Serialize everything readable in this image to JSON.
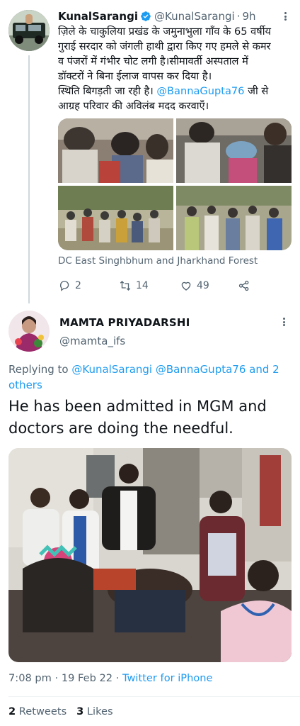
{
  "tweet1": {
    "display_name": "KunalSarangi",
    "handle": "@KunalSarangi",
    "separator": "·",
    "time": "9h",
    "text_lines": [
      "ज़िले के चाकुलिया प्रखंड के जमुनाभुला गाँव के 65 वर्षीय",
      "गुराई सरदार को जंगली हाथी द्वारा किए गए हमले से कमर",
      "व पंजरों में गंभीर चोट लगी है।सीमावर्ती अस्पताल में",
      "डॉक्टरों ने बिना ईलाज वापस कर दिया है।",
      "स्थिति बिगड़ती जा रही है।"
    ],
    "mention": "@BannaGupta76",
    "text_last_line": "जी से",
    "text_final": "आग्रह परिवार की अविलंब मदद करवाएँ।",
    "media_tag": "DC East Singhbhum and Jharkhand Forest",
    "reply_count": "2",
    "retweet_count": "14",
    "like_count": "49"
  },
  "tweet2": {
    "display_name": "MAMTA PRIYADARSHI",
    "handle": "@mamta_ifs",
    "replying_prefix": "Replying to",
    "replying_mention1": "@KunalSarangi",
    "replying_mention2": "@BannaGupta76",
    "replying_and": "and 2",
    "replying_others": "others",
    "text_line1": "He has been admitted in MGM and",
    "text_line2": "doctors are doing the needful.",
    "time": "7:08 pm",
    "separator": "·",
    "date": "19 Feb 22",
    "source": "Twitter for iPhone",
    "retweets_count": "2",
    "retweets_label": "Retweets",
    "likes_count": "3",
    "likes_label": "Likes"
  },
  "colors": {
    "accent": "#1d9bf0",
    "secondary_text": "#536471",
    "primary_text": "#0f1419"
  },
  "icons": [
    "verified-badge-icon",
    "more-options-icon",
    "reply-icon",
    "retweet-icon",
    "like-icon",
    "share-icon"
  ]
}
